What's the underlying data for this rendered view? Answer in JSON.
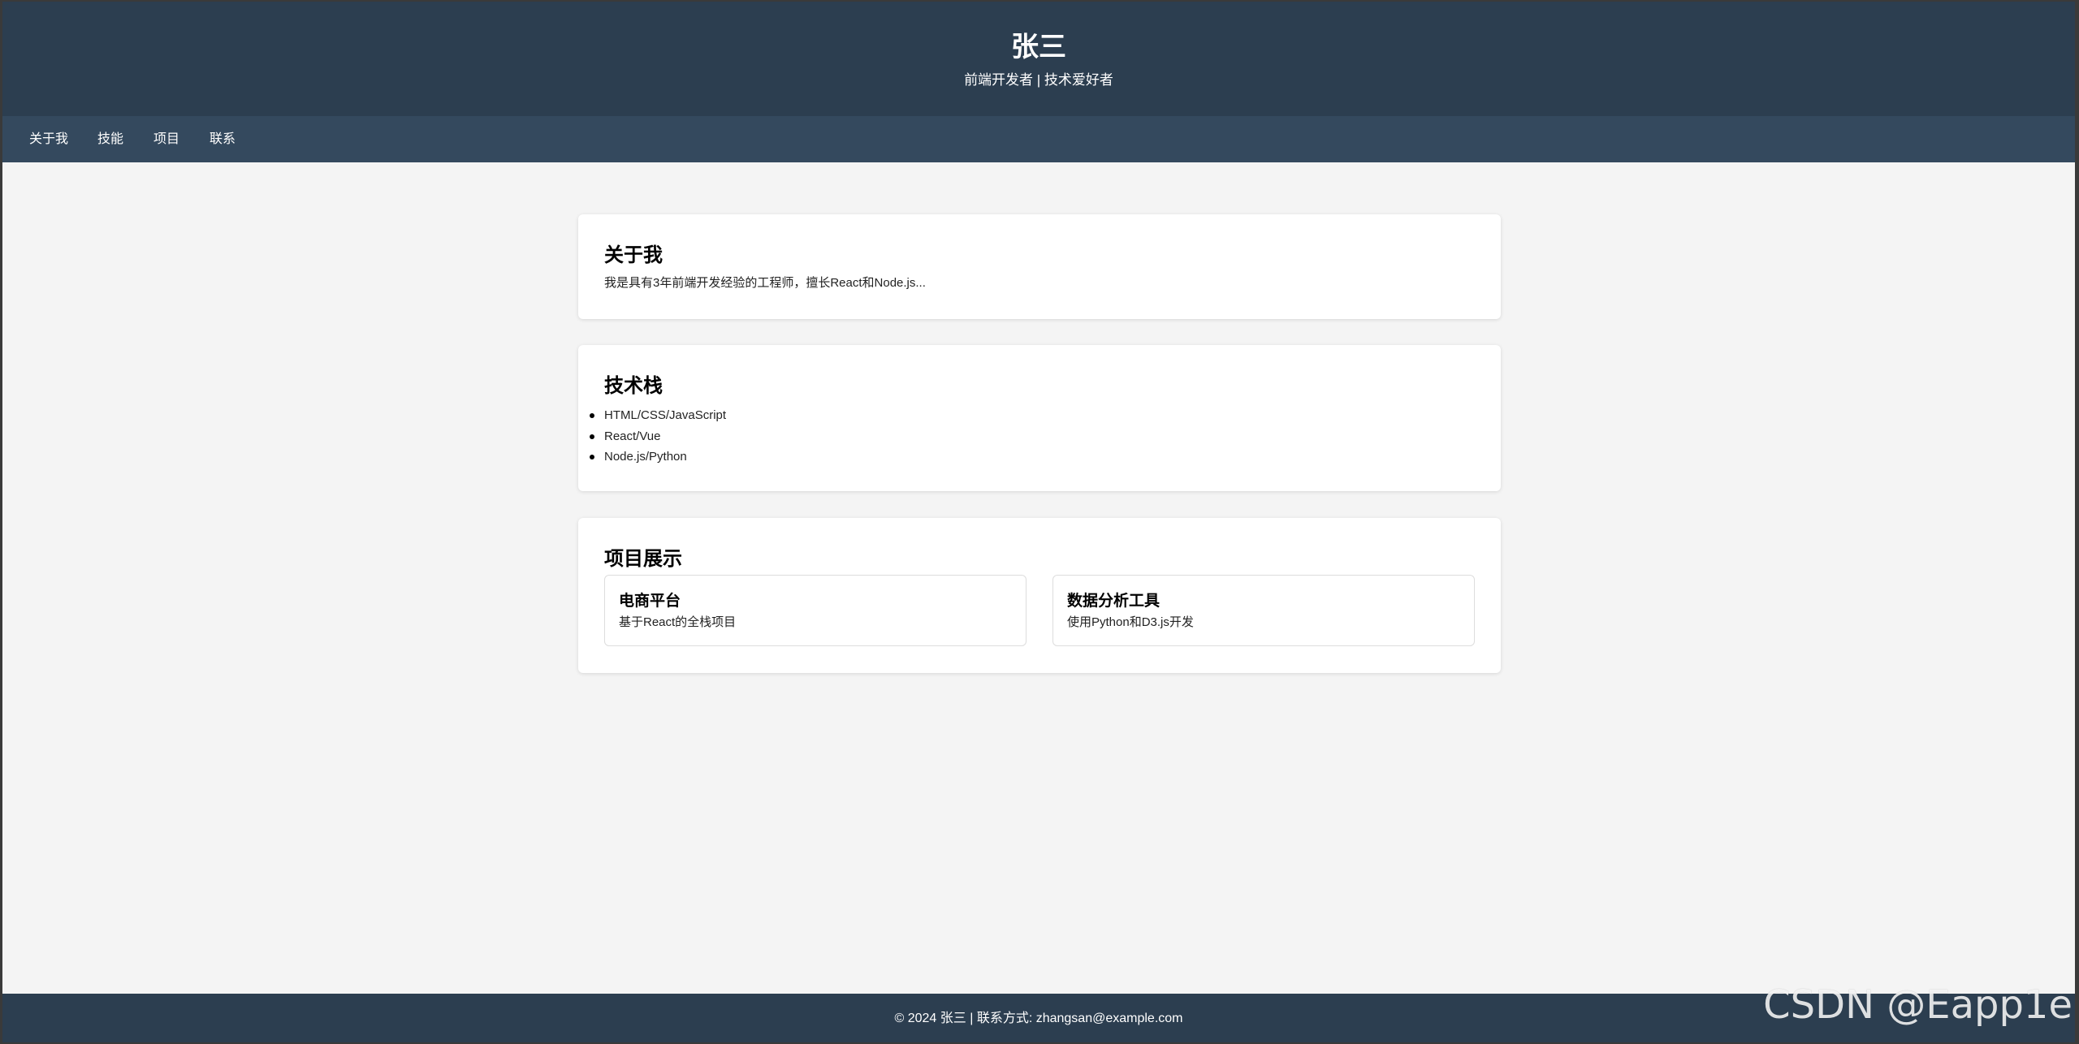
{
  "header": {
    "title": "张三",
    "subtitle": "前端开发者 | 技术爱好者"
  },
  "nav": {
    "items": [
      {
        "label": "关于我"
      },
      {
        "label": "技能"
      },
      {
        "label": "项目"
      },
      {
        "label": "联系"
      }
    ]
  },
  "about": {
    "heading": "关于我",
    "text": "我是具有3年前端开发经验的工程师，擅长React和Node.js..."
  },
  "skills": {
    "heading": "技术栈",
    "items": [
      "HTML/CSS/JavaScript",
      "React/Vue",
      "Node.js/Python"
    ]
  },
  "projects": {
    "heading": "项目展示",
    "items": [
      {
        "title": "电商平台",
        "description": "基于React的全栈项目"
      },
      {
        "title": "数据分析工具",
        "description": "使用Python和D3.js开发"
      }
    ]
  },
  "footer": {
    "text": "© 2024 张三 | 联系方式: zhangsan@example.com"
  },
  "watermark": "CSDN @Eapp1e",
  "colors": {
    "header_bg": "#2c3e50",
    "nav_bg": "#34495e",
    "page_bg": "#f4f4f4",
    "card_bg": "#ffffff"
  }
}
